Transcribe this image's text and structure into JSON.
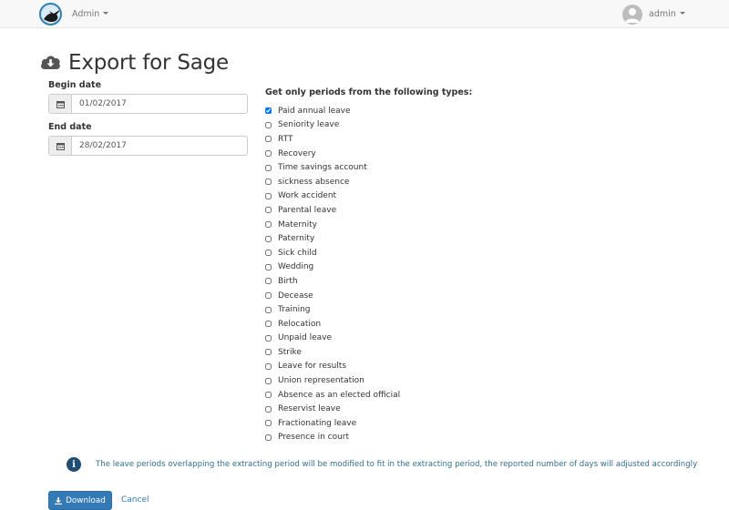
{
  "navbar": {
    "menu_label": "Admin",
    "user_label": "admin"
  },
  "page": {
    "title": "Export for Sage"
  },
  "form": {
    "begin_label": "Begin date",
    "begin_value": "01/02/2017",
    "end_label": "End date",
    "end_value": "28/02/2017",
    "types_heading": "Get only periods from the following types:",
    "types": [
      {
        "label": "Paid annual leave",
        "checked": true
      },
      {
        "label": "Seniority leave",
        "checked": false
      },
      {
        "label": "RTT",
        "checked": false
      },
      {
        "label": "Recovery",
        "checked": false
      },
      {
        "label": "Time savings account",
        "checked": false
      },
      {
        "label": "sickness absence",
        "checked": false
      },
      {
        "label": "Work accident",
        "checked": false
      },
      {
        "label": "Parental leave",
        "checked": false
      },
      {
        "label": "Maternity",
        "checked": false
      },
      {
        "label": "Paternity",
        "checked": false
      },
      {
        "label": "Sick child",
        "checked": false
      },
      {
        "label": "Wedding",
        "checked": false
      },
      {
        "label": "Birth",
        "checked": false
      },
      {
        "label": "Decease",
        "checked": false
      },
      {
        "label": "Training",
        "checked": false
      },
      {
        "label": "Relocation",
        "checked": false
      },
      {
        "label": "Unpaid leave",
        "checked": false
      },
      {
        "label": "Strike",
        "checked": false
      },
      {
        "label": "Leave for results",
        "checked": false
      },
      {
        "label": "Union representation",
        "checked": false
      },
      {
        "label": "Absence as an elected official",
        "checked": false
      },
      {
        "label": "Reservist leave",
        "checked": false
      },
      {
        "label": "Fractionating leave",
        "checked": false
      },
      {
        "label": "Presence in court",
        "checked": false
      }
    ]
  },
  "info": {
    "text": "The leave periods overlapping the extracting period will be modified to fit in the extracting period, the reported number of days will adjusted accordingly"
  },
  "actions": {
    "download_label": "Download",
    "cancel_label": "Cancel"
  },
  "colors": {
    "primary": "#337ab7",
    "info_text": "#31708f",
    "navbar_bg": "#f8f8f8"
  }
}
